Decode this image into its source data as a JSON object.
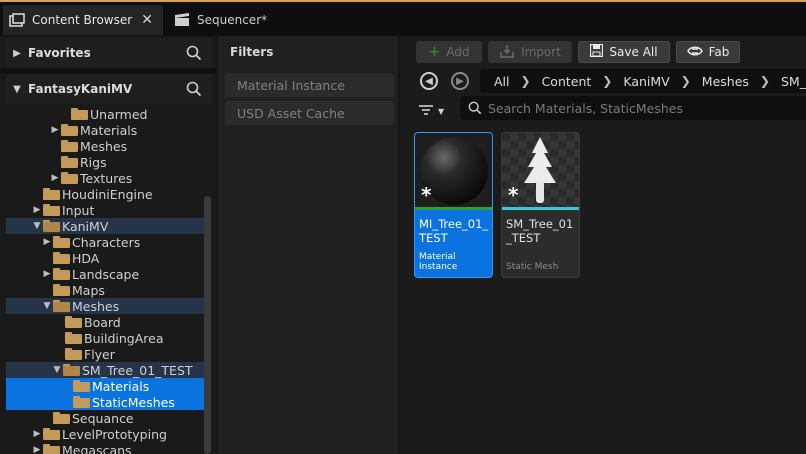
{
  "tabs": [
    {
      "label": "Content Browser",
      "close": "✕"
    },
    {
      "label": "Sequencer*"
    }
  ],
  "sidebar": {
    "favorites_label": "Favorites",
    "project_label": "FantasyKaniMV",
    "tree": [
      {
        "label": "Unarmed",
        "arrow": ""
      },
      {
        "label": "Materials",
        "arrow": "▶"
      },
      {
        "label": "Meshes",
        "arrow": ""
      },
      {
        "label": "Rigs",
        "arrow": ""
      },
      {
        "label": "Textures",
        "arrow": "▶"
      },
      {
        "label": "HoudiniEngine",
        "arrow": ""
      },
      {
        "label": "Input",
        "arrow": "▶"
      },
      {
        "label": "KaniMV",
        "arrow": "▼"
      },
      {
        "label": "Characters",
        "arrow": "▶"
      },
      {
        "label": "HDA",
        "arrow": ""
      },
      {
        "label": "Landscape",
        "arrow": "▶"
      },
      {
        "label": "Maps",
        "arrow": ""
      },
      {
        "label": "Meshes",
        "arrow": "▼"
      },
      {
        "label": "Board",
        "arrow": ""
      },
      {
        "label": "BuildingArea",
        "arrow": ""
      },
      {
        "label": "Flyer",
        "arrow": ""
      },
      {
        "label": "SM_Tree_01_TEST",
        "arrow": "▼"
      },
      {
        "label": "Materials",
        "arrow": ""
      },
      {
        "label": "StaticMeshes",
        "arrow": ""
      },
      {
        "label": "Sequance",
        "arrow": ""
      },
      {
        "label": "LevelPrototyping",
        "arrow": "▶"
      },
      {
        "label": "Megascans",
        "arrow": "▶"
      }
    ]
  },
  "filters": {
    "title": "Filters",
    "items": [
      "Material Instance",
      "USD Asset Cache"
    ]
  },
  "toolbar": {
    "add_label": "Add",
    "import_label": "Import",
    "save_all_label": "Save All",
    "fab_label": "Fab"
  },
  "breadcrumb": [
    "All",
    "Content",
    "KaniMV",
    "Meshes",
    "SM_T"
  ],
  "search": {
    "placeholder": "Search Materials, StaticMeshes"
  },
  "assets": [
    {
      "name": "MI_Tree_01_TEST",
      "type": "Material Instance",
      "modified_mark": "*"
    },
    {
      "name": "SM_Tree_01_TEST",
      "type": "Static Mesh",
      "modified_mark": "*"
    }
  ],
  "colors": {
    "accent": "#0a73e0",
    "folder": "#c49a5a",
    "tab_accent": "#d6a44a",
    "material_bar": "#2e9e3a",
    "mesh_bar": "#33c9d6"
  }
}
